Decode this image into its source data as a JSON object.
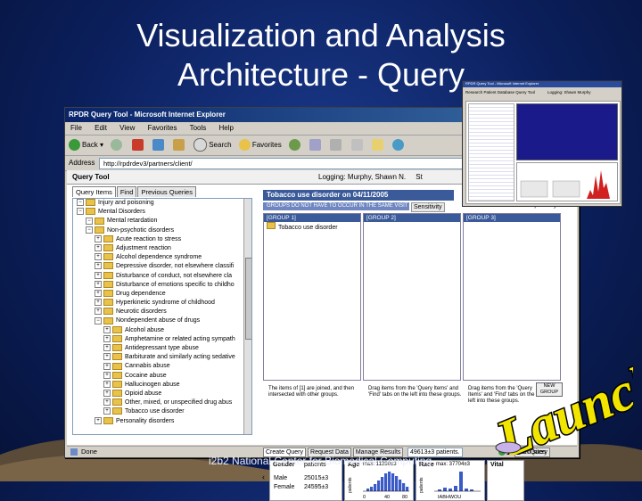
{
  "slide": {
    "title_line1": "Visualization and Analysis",
    "title_line2": "Architecture - Query",
    "footer": "i2b2 National Center for Biomedical Computing",
    "launch_text": "Launch"
  },
  "window": {
    "title": "RPDR Query Tool - Microsoft Internet Explorer",
    "menu": [
      "File",
      "Edit",
      "View",
      "Favorites",
      "Tools",
      "Help"
    ],
    "toolbar": {
      "back": "Back",
      "search": "Search",
      "favorites": "Favorites"
    },
    "address_label": "Address",
    "address_url": "http://rpdrdev3/partners/client/",
    "status_left": "Done",
    "status_right": "Trusted sites"
  },
  "app": {
    "title": "Query Tool",
    "login": "Logging: Murphy, Shawn N.",
    "login_tail": "St",
    "tabs": [
      "Query Items",
      "Find",
      "Previous Queries"
    ],
    "tree": [
      {
        "level": 1,
        "label": "Injury and poisoning"
      },
      {
        "level": 1,
        "label": "Mental Disorders"
      },
      {
        "level": 2,
        "label": "Mental retardation"
      },
      {
        "level": 2,
        "label": "Non-psychotic disorders"
      },
      {
        "level": 3,
        "label": "Acute reaction to stress"
      },
      {
        "level": 3,
        "label": "Adjustment reaction"
      },
      {
        "level": 3,
        "label": "Alcohol dependence syndrome"
      },
      {
        "level": 3,
        "label": "Depressive disorder, not elsewhere classifi"
      },
      {
        "level": 3,
        "label": "Disturbance of conduct, not elsewhere cla"
      },
      {
        "level": 3,
        "label": "Disturbance of emotions specific to childho"
      },
      {
        "level": 3,
        "label": "Drug dependence"
      },
      {
        "level": 3,
        "label": "Hyperkinetic syndrome of childhood"
      },
      {
        "level": 3,
        "label": "Neurotic disorders"
      },
      {
        "level": 3,
        "label": "Nondependent abuse of drugs"
      },
      {
        "level": 4,
        "label": "Alcohol abuse"
      },
      {
        "level": 4,
        "label": "Amphetamine or related acting sympath"
      },
      {
        "level": 4,
        "label": "Antidepressant type abuse"
      },
      {
        "level": 4,
        "label": "Barbiturate and similarly acting sedative"
      },
      {
        "level": 4,
        "label": "Cannabis abuse"
      },
      {
        "level": 4,
        "label": "Cocaine abuse"
      },
      {
        "level": 4,
        "label": "Hallucinogen abuse"
      },
      {
        "level": 4,
        "label": "Opioid abuse"
      },
      {
        "level": 4,
        "label": "Other, mixed, or unspecified drug abus"
      },
      {
        "level": 4,
        "label": "Tobacco use disorder"
      },
      {
        "level": 3,
        "label": "Personality disorders"
      }
    ],
    "query_name": "Tobacco use disorder on 04/11/2005",
    "query_constraint": "GROUPS DO NOT HAVE TO OCCUR IN THE SAME VISIT",
    "sensitivity": "Sensitivity",
    "specificity": "Specificity",
    "groups": [
      {
        "header": "[GROUP 1]",
        "item": "Tobacco use disorder",
        "help": "The items of [1] are joined, and then intersected with other groups."
      },
      {
        "header": "[GROUP 2]",
        "item": "",
        "help": "Drag items from the 'Query Items' and 'Find' tabs on the left into these groups."
      },
      {
        "header": "[GROUP 3]",
        "item": "",
        "help": "Drag items from the 'Query Items' and 'Find' tabs on the left into these groups."
      }
    ],
    "new_group": "NEW GROUP",
    "bottom_tabs": [
      "Create Query",
      "Request Data",
      "Manage Results"
    ],
    "patient_count": "49613±3 patients.",
    "run_query": "Run Query",
    "results": {
      "gender_label": "Gender",
      "patients_label": "patients",
      "male_label": "Male",
      "male_value": "25015±3",
      "female_label": "Female",
      "female_value": "24595±3",
      "age_label": "Age",
      "age_max": "max: 11380±3",
      "age_ticks": [
        "0",
        "40",
        "80"
      ],
      "race_label": "Race",
      "race_max": "max: 37704±3",
      "race_ticks": "IABHWOU",
      "vital_label": "Vital"
    }
  },
  "mini_window": {
    "title": "RPDR Query Tool - Microsoft Internet Explorer",
    "app_title": "Research Patient Database Query Tool",
    "login": "Logging: Shawn Murphy"
  }
}
